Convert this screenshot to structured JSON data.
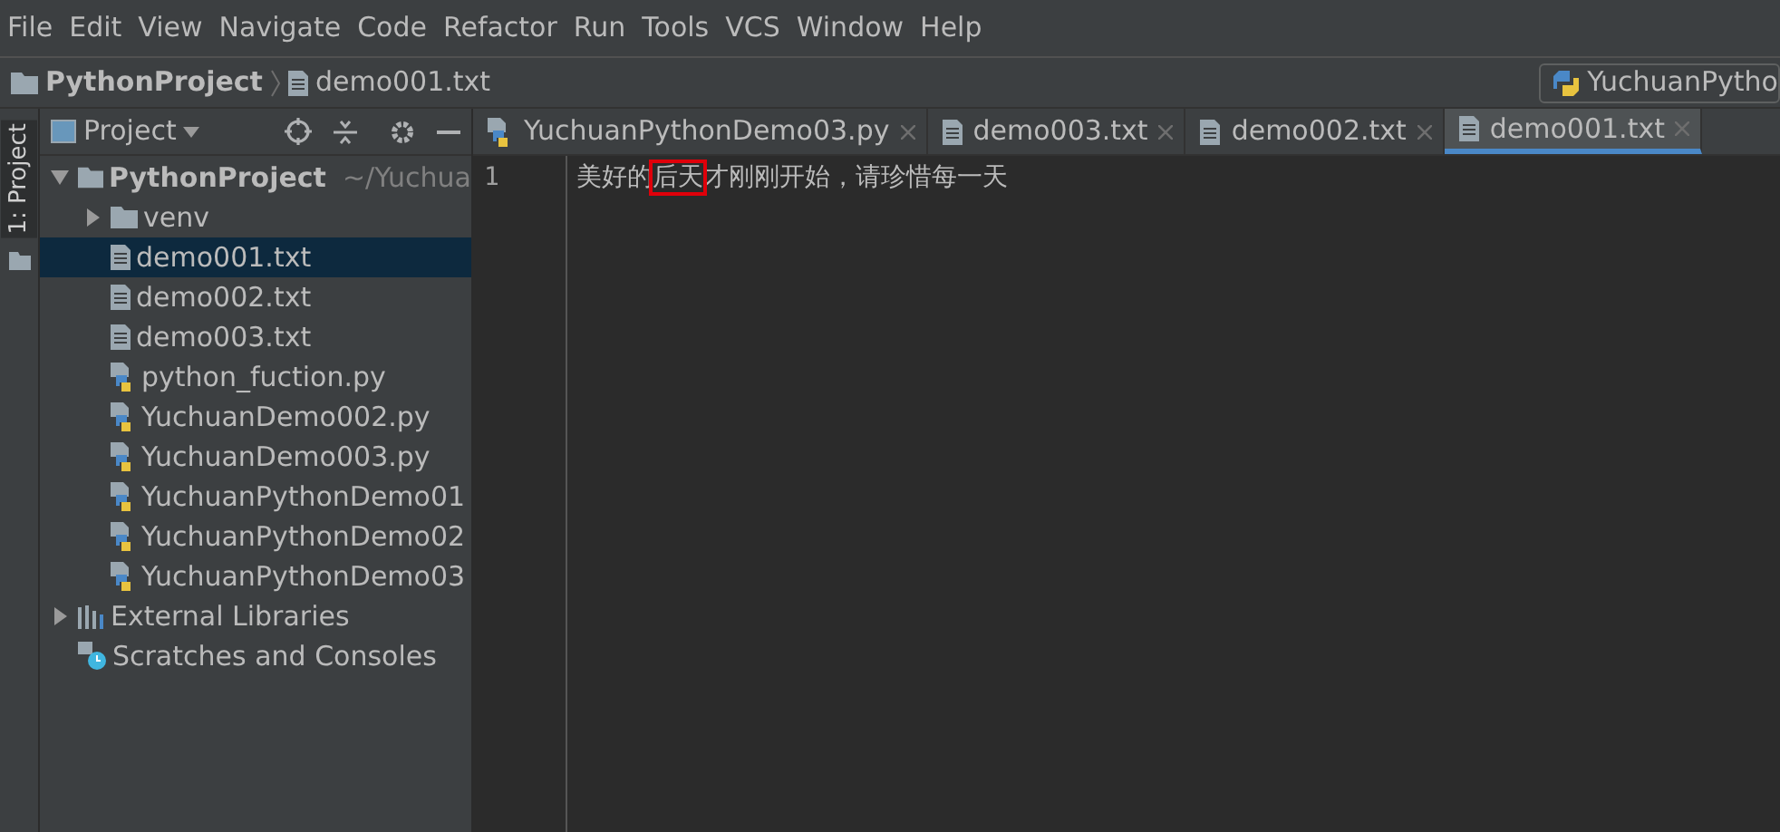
{
  "menu": [
    "File",
    "Edit",
    "View",
    "Navigate",
    "Code",
    "Refactor",
    "Run",
    "Tools",
    "VCS",
    "Window",
    "Help"
  ],
  "breadcrumb": [
    {
      "label": "PythonProject",
      "kind": "folder"
    },
    {
      "label": "demo001.txt",
      "kind": "txt"
    }
  ],
  "run_config": {
    "label": "YuchuanPytho"
  },
  "side_tab": {
    "label": "1: Project",
    "selected": true
  },
  "project_panel": {
    "title": "Project",
    "tree": [
      {
        "label": "PythonProject",
        "path": "~/Yuchua",
        "kind": "folder",
        "expanded": true,
        "selected": false,
        "children": [
          {
            "label": "venv",
            "kind": "folder",
            "expanded": false,
            "selected": false
          },
          {
            "label": "demo001.txt",
            "kind": "txt",
            "selected": true
          },
          {
            "label": "demo002.txt",
            "kind": "txt",
            "selected": false
          },
          {
            "label": "demo003.txt",
            "kind": "txt",
            "selected": false
          },
          {
            "label": "python_fuction.py",
            "kind": "py",
            "selected": false
          },
          {
            "label": "YuchuanDemo002.py",
            "kind": "py",
            "selected": false
          },
          {
            "label": "YuchuanDemo003.py",
            "kind": "py",
            "selected": false
          },
          {
            "label": "YuchuanPythonDemo01",
            "kind": "py",
            "selected": false
          },
          {
            "label": "YuchuanPythonDemo02",
            "kind": "py",
            "selected": false
          },
          {
            "label": "YuchuanPythonDemo03",
            "kind": "py",
            "selected": false
          }
        ]
      },
      {
        "label": "External Libraries",
        "kind": "libraries",
        "expanded": false,
        "selected": false
      },
      {
        "label": "Scratches and Consoles",
        "kind": "scratches",
        "selected": false
      }
    ]
  },
  "tabs": [
    {
      "label": "YuchuanPythonDemo03.py",
      "kind": "py",
      "selected": false
    },
    {
      "label": "demo003.txt",
      "kind": "txt",
      "selected": false
    },
    {
      "label": "demo002.txt",
      "kind": "txt",
      "selected": false
    },
    {
      "label": "demo001.txt",
      "kind": "txt",
      "selected": true
    }
  ],
  "editor": {
    "lines": [
      {
        "number": "1",
        "segments": [
          {
            "text": "美好的",
            "highlighted": false
          },
          {
            "text": "后天",
            "highlighted": true
          },
          {
            "text": "才刚刚开始，请珍惜每一天",
            "highlighted": false
          }
        ]
      }
    ]
  }
}
